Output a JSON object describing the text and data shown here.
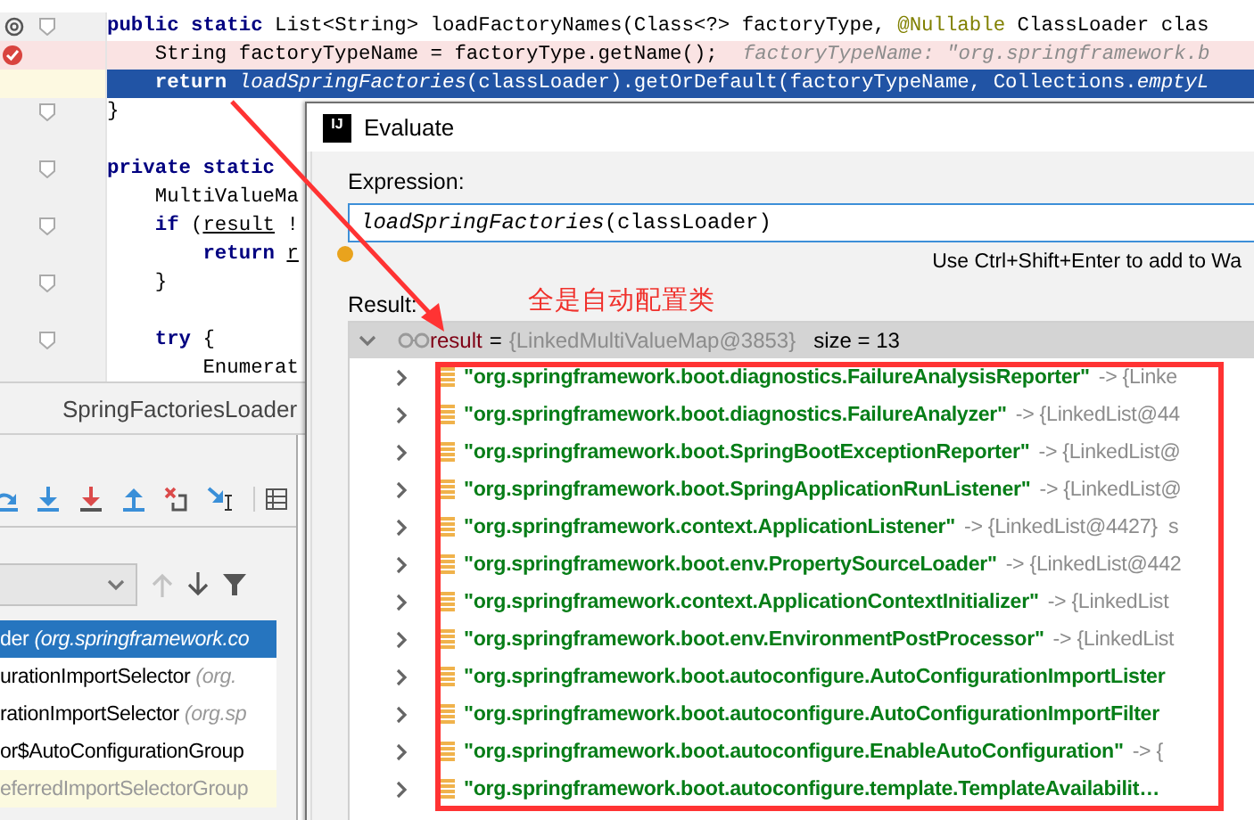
{
  "editor": {
    "lines": [
      {
        "current": false,
        "breakpoint": false,
        "override": true,
        "fold": true,
        "blank_before": false,
        "segments": [
          {
            "kind": "kw",
            "text": "public static "
          },
          {
            "kind": "plain",
            "text": "List<String> loadFactoryNames(Class<?> factoryType, "
          },
          {
            "kind": "annotation",
            "text": "@Nullable"
          },
          {
            "kind": "plain",
            "text": " ClassLoader clas"
          }
        ]
      },
      {
        "current": false,
        "breakpoint": true,
        "override": false,
        "fold": false,
        "blank_before": false,
        "segments": [
          {
            "kind": "plain",
            "text": "    String factoryTypeName = factoryType.getName();"
          },
          {
            "kind": "hint",
            "text": "factoryTypeName: \"org.springframework.b"
          }
        ]
      },
      {
        "current": true,
        "breakpoint": false,
        "override": false,
        "fold": false,
        "blank_before": false,
        "segments": [
          {
            "kind": "kw",
            "text": "    return "
          },
          {
            "kind": "italic",
            "text": "loadSpringFactories"
          },
          {
            "kind": "plain",
            "text": "(classLoader).getOrDefault(factoryTypeName, Collections."
          },
          {
            "kind": "italic",
            "text": "emptyL"
          }
        ]
      },
      {
        "current": false,
        "breakpoint": false,
        "override": false,
        "fold": true,
        "blank_before": false,
        "segments": [
          {
            "kind": "plain",
            "text": "}"
          }
        ]
      },
      {
        "current": false,
        "breakpoint": false,
        "override": false,
        "fold": true,
        "blank_before": true,
        "segments": [
          {
            "kind": "kw",
            "text": "private static"
          }
        ]
      },
      {
        "current": false,
        "breakpoint": false,
        "override": false,
        "fold": false,
        "blank_before": false,
        "segments": [
          {
            "kind": "plain",
            "text": "    MultiValueMa"
          }
        ]
      },
      {
        "current": false,
        "breakpoint": false,
        "override": false,
        "fold": true,
        "blank_before": false,
        "segments": [
          {
            "kind": "kw",
            "text": "    if "
          },
          {
            "kind": "plain",
            "text": "("
          },
          {
            "kind": "ref",
            "text": "result"
          },
          {
            "kind": "plain",
            "text": " !"
          }
        ]
      },
      {
        "current": false,
        "breakpoint": false,
        "override": false,
        "fold": false,
        "blank_before": false,
        "segments": [
          {
            "kind": "kw",
            "text": "        return "
          },
          {
            "kind": "ref",
            "text": "r"
          }
        ]
      },
      {
        "current": false,
        "breakpoint": false,
        "override": false,
        "fold": true,
        "blank_before": false,
        "segments": [
          {
            "kind": "plain",
            "text": "    }"
          }
        ]
      },
      {
        "current": false,
        "breakpoint": false,
        "override": false,
        "fold": true,
        "blank_before": true,
        "segments": [
          {
            "kind": "kw",
            "text": "    try "
          },
          {
            "kind": "plain",
            "text": "{"
          }
        ]
      },
      {
        "current": false,
        "breakpoint": false,
        "override": false,
        "fold": false,
        "blank_before": false,
        "segments": [
          {
            "kind": "plain",
            "text": "        Enumerat"
          }
        ]
      }
    ]
  },
  "file_tab": {
    "label": "SpringFactoriesLoader"
  },
  "frames": [
    {
      "method": "der",
      "location": "(org.springframework.co",
      "selected": true,
      "library": false
    },
    {
      "method": "urationImportSelector",
      "location": "(org.",
      "selected": false,
      "library": false
    },
    {
      "method": "rationImportSelector",
      "location": "(org.sp",
      "selected": false,
      "library": false
    },
    {
      "method": "or$AutoConfigurationGroup",
      "selected": false,
      "library": false
    },
    {
      "method": "eferredImportSelectorGroup",
      "selected": false,
      "library": true
    }
  ],
  "dialog": {
    "logo": "IJ",
    "title": "Evaluate",
    "expression_label": "Expression:",
    "expression": "*loadSpringFactories*(classLoader)",
    "hint": "Use Ctrl+Shift+Enter to add to Wa",
    "result_label": "Result:",
    "note": "全是自动配置类",
    "root": {
      "name": "result",
      "equals": "=",
      "value": "{LinkedMultiValueMap@3853}",
      "size": "size = 13",
      "expanded": true
    },
    "entries": [
      {
        "key": "\"org.springframework.boot.diagnostics.FailureAnalysisReporter\"",
        "value": "-> {Linke",
        "expanded": false
      },
      {
        "key": "\"org.springframework.boot.diagnostics.FailureAnalyzer\"",
        "value": "-> {LinkedList@44",
        "expanded": false
      },
      {
        "key": "\"org.springframework.boot.SpringBootExceptionReporter\"",
        "value": "-> {LinkedList@",
        "expanded": false
      },
      {
        "key": "\"org.springframework.boot.SpringApplicationRunListener\"",
        "value": "-> {LinkedList@",
        "expanded": false
      },
      {
        "key": "\"org.springframework.context.ApplicationListener\"",
        "value": "-> {LinkedList@4427}  s",
        "expanded": false
      },
      {
        "key": "\"org.springframework.boot.env.PropertySourceLoader\"",
        "value": "-> {LinkedList@442",
        "expanded": false
      },
      {
        "key": "\"org.springframework.context.ApplicationContextInitializer\"",
        "value": "-> {LinkedList",
        "expanded": false
      },
      {
        "key": "\"org.springframework.boot.env.EnvironmentPostProcessor\"",
        "value": "-> {LinkedList",
        "expanded": false
      },
      {
        "key": "\"org.springframework.boot.autoconfigure.AutoConfigurationImportLister",
        "expanded": false
      },
      {
        "key": "\"org.springframework.boot.autoconfigure.AutoConfigurationImportFilter",
        "expanded": false
      },
      {
        "key": "\"org.springframework.boot.autoconfigure.EnableAutoConfiguration\"",
        "value": "-> {",
        "expanded": false
      },
      {
        "key": "\"org.springframework.boot.autoconfigure.template.TemplateAvailabilit…",
        "expanded": false
      }
    ]
  }
}
